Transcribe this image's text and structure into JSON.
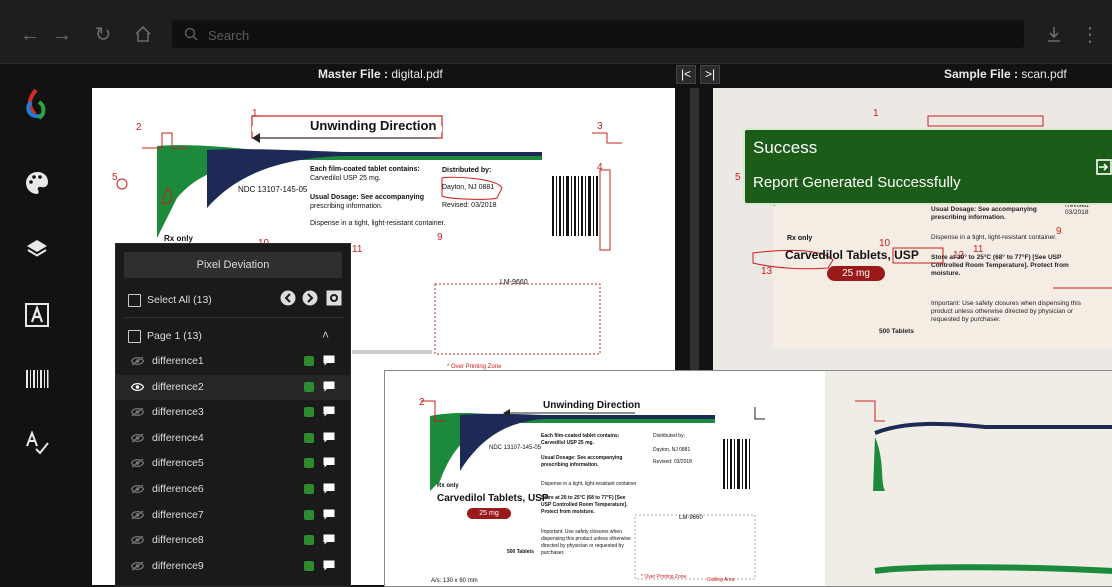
{
  "toolbar": {
    "search_placeholder": "Search"
  },
  "files": {
    "master_label": "Master File :",
    "master_name": "digital.pdf",
    "sample_label": "Sample File :",
    "sample_name": "scan.pdf"
  },
  "toast": {
    "title": "Success",
    "message": "Report Generated Successfully",
    "color": "#1b5c18"
  },
  "panel": {
    "header": "Pixel Deviation",
    "select_all": "Select All (13)",
    "page_label": "Page 1 (13)",
    "items": [
      {
        "label": "difference1",
        "visible": false
      },
      {
        "label": "difference2",
        "visible": true
      },
      {
        "label": "difference3",
        "visible": false
      },
      {
        "label": "difference4",
        "visible": false
      },
      {
        "label": "difference5",
        "visible": false
      },
      {
        "label": "difference6",
        "visible": false
      },
      {
        "label": "difference7",
        "visible": false
      },
      {
        "label": "difference8",
        "visible": false
      },
      {
        "label": "difference9",
        "visible": false
      }
    ]
  },
  "master_doc": {
    "title": "Unwinding Direction",
    "film_coated": "Each film-coated tablet contains:",
    "carvedilol_dose": "Carvedilol USP 25 mg.",
    "distributed_by": "Distributed by:",
    "dayton": "Dayton, NJ 0881",
    "revised": "Revised: 03/2018",
    "ndc": "NDC 13107-145-05",
    "usual_dosage": "Usual Dosage: See accompanying",
    "prescribing": "prescribing information.",
    "rx_only": "Rx only",
    "dispense": "Dispense in a tight, light-resistant container.",
    "lm_code": "LM-9660",
    "overprint": "* Over Printing Zone"
  },
  "markers": [
    "1",
    "2",
    "3",
    "4",
    "5",
    "8",
    "9",
    "10",
    "11"
  ],
  "sample_doc": {
    "carvedilol": "Carvedilol Tablets, USP",
    "dose": "25 mg",
    "tablets": "500 Tablets",
    "rx_only": "Rx only",
    "dispense": "Dispense in a tight, light-resistant container.",
    "store": "Store at 20° to 25°C (68° to 77°F) [See USP Controlled Room Temperature]. Protect from moisture.",
    "important": "Important: Use safety closures when dispensing this product unless otherwise directed by physician or requested by purchaser.",
    "usual": "Usual Dosage: See accompanying prescribing information.",
    "revised": "Revised: 03/2018",
    "markers": [
      "1",
      "5",
      "9",
      "10",
      "11",
      "12",
      "13"
    ]
  },
  "zoom_doc": {
    "title": "Unwinding Direction",
    "ndc": "NDC 13107-145-05",
    "film": "Each film-coated tablet contains: Carvedilol USP 25 mg.",
    "distributed": "Distributed by:",
    "dayton": "Dayton, NJ 0881",
    "revised": "Revised: 03/2018",
    "usual": "Usual Dosage: See accompanying prescribing information.",
    "rx_only": "Rx only",
    "dispense": "Dispense in a tight, light-resistant container",
    "carvedilol": "Carvedilol Tablets, USP",
    "dose": "25 mg",
    "store": "Store at 20 to 25°C (68 to 77°F) [See USP Controlled Room Temperature]. Protect from moisture.",
    "important": "Important: Use safety closures when dispensing this product unless otherwise directed by physician or requested by purchaser.",
    "tablets": "500 Tablets",
    "lm": "LM-9660",
    "size": "A/s: 130 x 60 mm",
    "overprint": "* Over Printing Zone",
    "cutting": "Cutting Area",
    "marker": "2"
  }
}
